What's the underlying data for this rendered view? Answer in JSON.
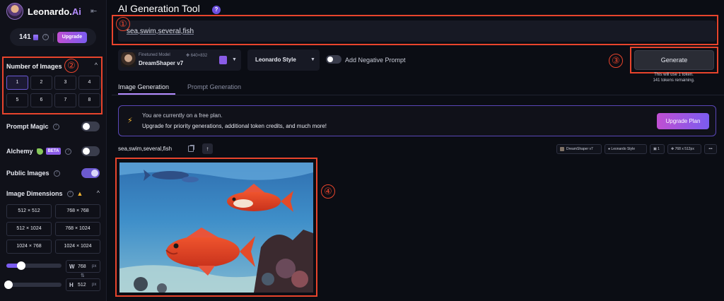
{
  "sidebar": {
    "brand_prefix": "Leonardo.",
    "brand_suffix": "Ai",
    "tokens": "141",
    "upgrade_label": "Upgrade",
    "number_of_images": {
      "title": "Number of Images",
      "marker": "②",
      "options": [
        "1",
        "2",
        "3",
        "4",
        "5",
        "6",
        "7",
        "8"
      ],
      "selected": "1"
    },
    "prompt_magic_label": "Prompt Magic",
    "alchemy_label": "Alchemy",
    "beta_label": "BETA",
    "public_images_label": "Public Images",
    "image_dimensions": {
      "title": "Image Dimensions",
      "options": [
        "512 × 512",
        "768 × 768",
        "512 × 1024",
        "768 × 1024",
        "1024 × 768",
        "1024 × 1024"
      ]
    },
    "width": {
      "letter": "W",
      "value": "768",
      "unit": "px"
    },
    "height": {
      "letter": "H",
      "value": "512",
      "unit": "px"
    }
  },
  "main": {
    "title": "AI Generation Tool",
    "prompt_value": "sea,swim,several,fish",
    "markers": {
      "prompt": "①",
      "generate": "③",
      "image": "④"
    },
    "model": {
      "subtitle": "Finetuned Model",
      "resolution": "640×832",
      "name": "DreamShaper v7"
    },
    "style_label": "Leonardo Style",
    "negative_prompt_label": "Add Negative Prompt",
    "generate_label": "Generate",
    "generate_note_1": "This will use 1 token.",
    "generate_note_2": "141 tokens remaining.",
    "tabs": [
      {
        "label": "Image Generation",
        "active": true
      },
      {
        "label": "Prompt Generation",
        "active": false
      }
    ],
    "banner": {
      "line1": "You are currently on a free plan.",
      "line2": "Upgrade for priority generations, additional token credits, and much more!",
      "button": "Upgrade Plan"
    },
    "result": {
      "prompt": "sea,swim,several,fish",
      "chips": [
        "DreamShaper v7",
        "Leonardo Style",
        "1",
        "768 x 512px",
        "•••"
      ]
    }
  },
  "colors": {
    "accent_purple": "#7b5cf0",
    "annotation_red": "#e8442c",
    "background": "#0b0d14"
  }
}
